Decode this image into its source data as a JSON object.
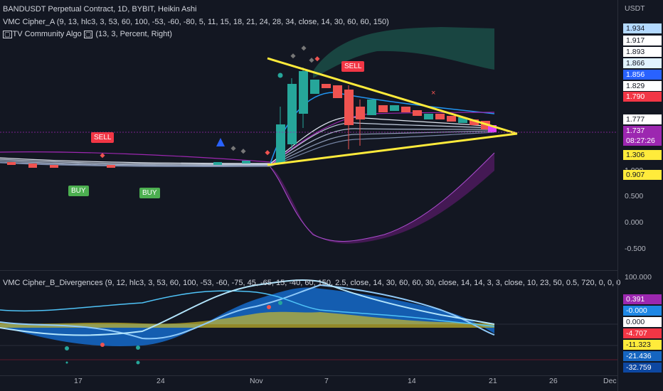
{
  "header": {
    "symbol_line": "BANDUSDT Perpetual Contract, 1D, BYBIT, Heikin Ashi",
    "indicator1": "VMC Cipher_A (9, 13, hlc3, 3, 53, 60, 100, -53, -60, -80, 5, 11, 15, 18, 21, 24, 28, 34, close, 14, 30, 60, 60, 150)",
    "indicator2": "TV Community Algo",
    "indicator2_params": "(13, 3, Percent, Right)",
    "indicator3": "VMC Cipher_B_Divergences (9, 12, hlc3, 3, 53, 60, 100, -53, -60, -75, 45, -65, 15, -40, 60, 150, 2.5, close, 14, 30, 60, 60, 30, close, 14, 14, 3, 3, close, 10, 23, 50, 0.5, 720, 0, 0, 0"
  },
  "price_axis": {
    "currency": "USDT",
    "ticks": [
      "1.000",
      "0.500",
      "0.000",
      "-0.500"
    ],
    "tags": [
      {
        "text": "1.934",
        "bg": "#b3d9ff",
        "fg": "#131722"
      },
      {
        "text": "1.917",
        "bg": "#ffffff",
        "fg": "#131722"
      },
      {
        "text": "1.893",
        "bg": "#ffffff",
        "fg": "#131722"
      },
      {
        "text": "1.866",
        "bg": "#e0f2ff",
        "fg": "#131722"
      },
      {
        "text": "1.856",
        "bg": "#2962ff",
        "fg": "#ffffff"
      },
      {
        "text": "1.829",
        "bg": "#ffffff",
        "fg": "#131722"
      },
      {
        "text": "1.790",
        "bg": "#f23645",
        "fg": "#ffffff"
      },
      {
        "text": "1.777",
        "bg": "#ffffff",
        "fg": "#131722"
      },
      {
        "text": "1.737",
        "bg": "#9c27b0",
        "fg": "#ffffff"
      },
      {
        "text": "08:27:26",
        "bg": "#9c27b0",
        "fg": "#ffffff"
      },
      {
        "text": "1.306",
        "bg": "#ffeb3b",
        "fg": "#131722"
      },
      {
        "text": "0.907",
        "bg": "#ffeb3b",
        "fg": "#131722"
      }
    ]
  },
  "osc_axis": {
    "top_label": "100.000",
    "tags": [
      {
        "text": "0.391",
        "bg": "#9c27b0",
        "fg": "#ffffff"
      },
      {
        "text": "-0.000",
        "bg": "#1e88e5",
        "fg": "#ffffff"
      },
      {
        "text": "0.000",
        "bg": "#ffffff",
        "fg": "#131722"
      },
      {
        "text": "-4.707",
        "bg": "#f23645",
        "fg": "#ffffff"
      },
      {
        "text": "-11.323",
        "bg": "#ffeb3b",
        "fg": "#131722"
      },
      {
        "text": "-21.436",
        "bg": "#1565c0",
        "fg": "#ffffff"
      },
      {
        "text": "-32.759",
        "bg": "#0d47a1",
        "fg": "#ffffff"
      }
    ]
  },
  "time_axis": [
    "17",
    "24",
    "Nov",
    "7",
    "14",
    "21",
    "26",
    "Dec"
  ],
  "signals": {
    "sell1": "SELL",
    "sell2": "SELL",
    "buy1": "BUY",
    "buy2": "BUY"
  },
  "colors": {
    "background": "#131722",
    "up": "#26a69a",
    "down": "#ef5350",
    "wedge": "#ffeb3b",
    "band_teal": "#1b4d47",
    "band_purple": "#4a1a5a"
  }
}
